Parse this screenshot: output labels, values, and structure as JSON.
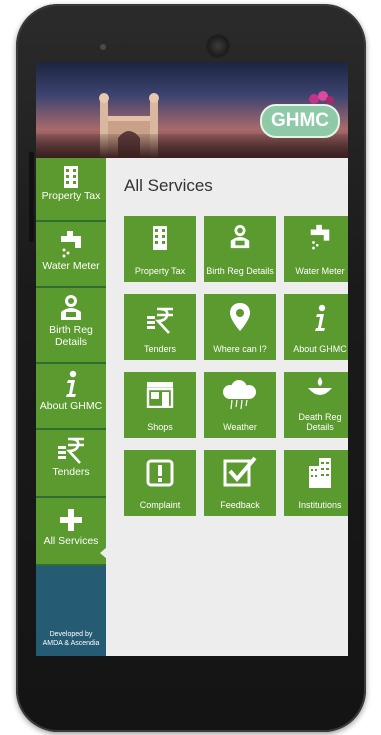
{
  "brand": {
    "logo_text": "GHMC"
  },
  "sidebar": {
    "items": [
      {
        "label": "Property Tax",
        "icon": "building-icon"
      },
      {
        "label": "Water Meter",
        "icon": "tap-icon"
      },
      {
        "label": "Birth Reg Details",
        "icon": "baby-icon"
      },
      {
        "label": "About GHMC",
        "icon": "info-icon"
      },
      {
        "label": "Tenders",
        "icon": "rupee-icon"
      },
      {
        "label": "All Services",
        "icon": "plus-icon"
      }
    ],
    "developer_line1": "Developed by",
    "developer_line2": "AMDA & Ascendia"
  },
  "main": {
    "title": "All Services",
    "tiles": [
      {
        "label": "Property Tax",
        "icon": "building-icon"
      },
      {
        "label": "Birth Reg Details",
        "icon": "baby-icon"
      },
      {
        "label": "Water Meter",
        "icon": "tap-icon"
      },
      {
        "label": "Tenders",
        "icon": "rupee-icon"
      },
      {
        "label": "Where can I?",
        "icon": "location-pin-icon"
      },
      {
        "label": "About GHMC",
        "icon": "info-icon"
      },
      {
        "label": "Shops",
        "icon": "shop-icon"
      },
      {
        "label": "Weather",
        "icon": "rain-cloud-icon"
      },
      {
        "label": "Death Reg Details",
        "icon": "lamp-icon"
      },
      {
        "label": "Complaint",
        "icon": "alert-icon"
      },
      {
        "label": "Feedback",
        "icon": "checkbox-icon"
      },
      {
        "label": "Institutions",
        "icon": "buildings-icon"
      }
    ]
  },
  "colors": {
    "tile_green": "#5a9a2e",
    "sidebar_blue": "#255c73",
    "divider_green": "#2f6e33"
  }
}
